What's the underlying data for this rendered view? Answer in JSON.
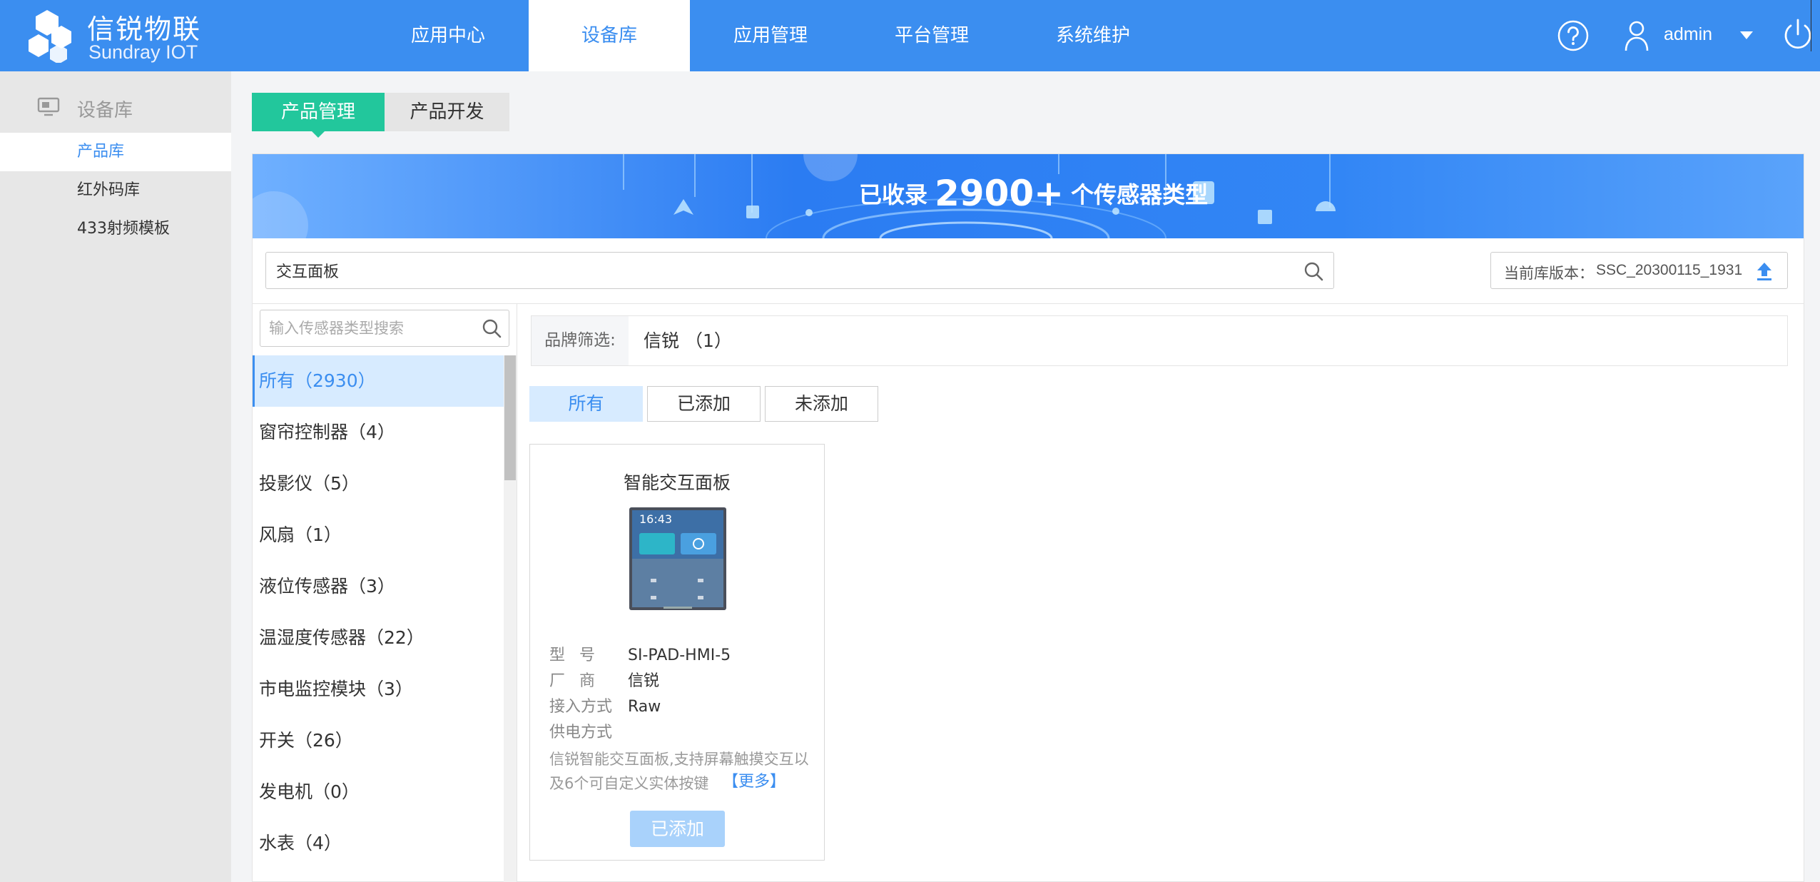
{
  "header": {
    "logo_title": "信锐物联",
    "logo_subtitle": "Sundray IOT",
    "nav": [
      "应用中心",
      "设备库",
      "应用管理",
      "平台管理",
      "系统维护"
    ],
    "active_nav": 1,
    "user": "admin",
    "accent_color": "#3b8ef0"
  },
  "sidebar": {
    "section": "设备库",
    "items": [
      "产品库",
      "红外码库",
      "433射频模板"
    ],
    "active_item": 0
  },
  "subtabs": [
    "产品管理",
    "产品开发"
  ],
  "banner": {
    "prefix": "已收录",
    "count": "2900+",
    "suffix": "个传感器类型"
  },
  "search": {
    "value": "交互面板",
    "category_placeholder": "输入传感器类型搜索"
  },
  "version": {
    "label": "当前库版本：",
    "value": "SSC_20300115_1931"
  },
  "categories": [
    "所有（2930）",
    "窗帘控制器（4）",
    "投影仪（5）",
    "风扇（1）",
    "液位传感器（3）",
    "温湿度传感器（22）",
    "市电监控模块（3）",
    "开关（26）",
    "发电机（0）",
    "水表（4）"
  ],
  "brand_filter": {
    "label": "品牌筛选:",
    "value": "信锐 （1）"
  },
  "filters": [
    "所有",
    "已添加",
    "未添加"
  ],
  "product": {
    "name": "智能交互面板",
    "thumb_time": "16:43",
    "model_label": "型号",
    "model": "SI-PAD-HMI-5",
    "vendor_label": "厂商",
    "vendor": "信锐",
    "access_label": "接入方式",
    "access": "Raw",
    "power_label": "供电方式",
    "power": "",
    "description": "信锐智能交互面板,支持屏幕触摸交互以及6个可自定义实体按键",
    "more": "【更多】",
    "status_button": "已添加"
  }
}
